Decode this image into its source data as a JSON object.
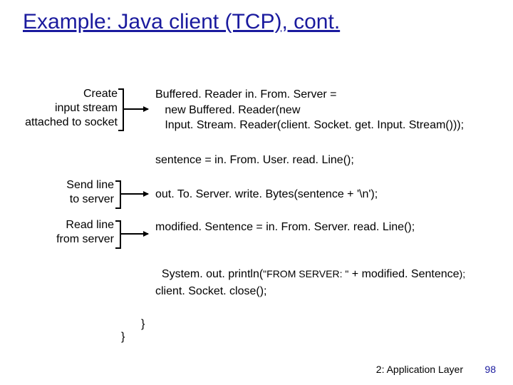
{
  "title": "Example: Java client (TCP), cont.",
  "labels": {
    "createStream": "Create\ninput stream\nattached to socket",
    "sendLine": "Send line\nto server",
    "readLine": "Read line\nfrom server"
  },
  "code": {
    "block1": "Buffered. Reader in. From. Server =\n   new Buffered. Reader(new\n   Input. Stream. Reader(client. Socket. get. Input. Stream()));",
    "sentence": "sentence = in. From. User. read. Line();",
    "out": "out. To. Server. write. Bytes(sentence + '\\n');",
    "modified": "modified. Sentence = in. From. Server. read. Line();",
    "print_a": "System. out. println(",
    "print_q1": "\"FROM SERVER: \"",
    "print_b": " + modified. Sentence",
    "print_c": ");",
    "close": "client. Socket. close();",
    "brace1": "}",
    "brace2": "}"
  },
  "footer": {
    "chapter": "2: Application Layer",
    "page": "98"
  }
}
